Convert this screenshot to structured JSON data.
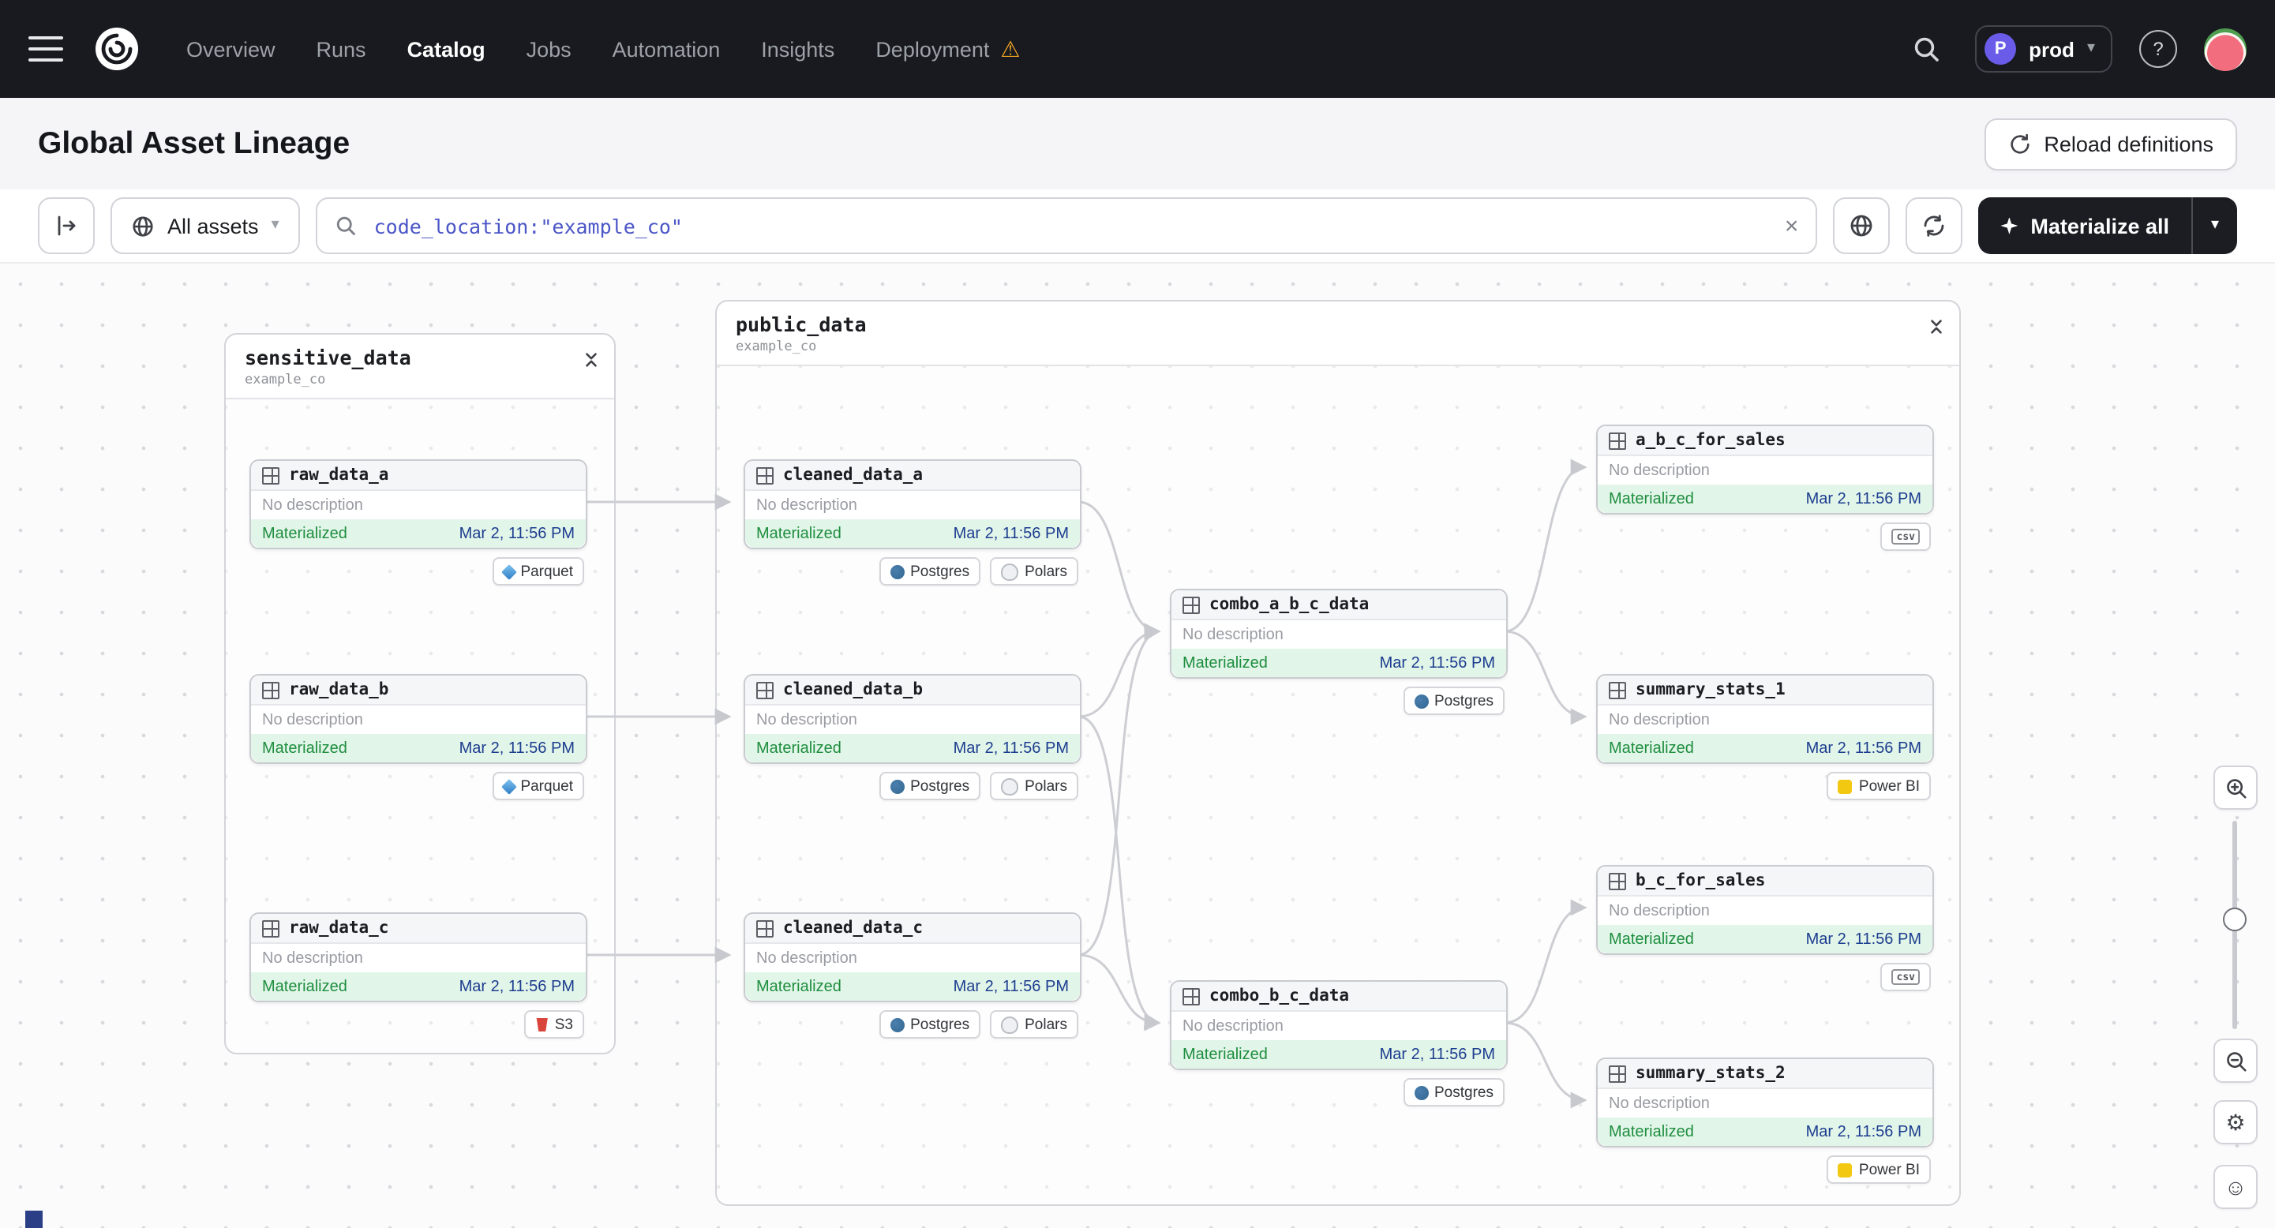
{
  "navbar": {
    "links": [
      {
        "label": "Overview"
      },
      {
        "label": "Runs"
      },
      {
        "label": "Catalog"
      },
      {
        "label": "Jobs"
      },
      {
        "label": "Automation"
      },
      {
        "label": "Insights"
      },
      {
        "label": "Deployment"
      }
    ],
    "active_link": "Catalog",
    "env": {
      "initial": "P",
      "name": "prod"
    }
  },
  "header": {
    "title": "Global Asset Lineage",
    "reload_button": "Reload definitions"
  },
  "toolbar": {
    "asset_filter_label": "All assets",
    "search_value": "code_location:\"example_co\"",
    "materialize_label": "Materialize all"
  },
  "icons": {
    "caret_down": "▾",
    "warning": "⚠",
    "close": "×",
    "gear": "⚙",
    "smiley": "☺",
    "question_mark": "?"
  },
  "colors": {
    "navbar_bg": "#181a1f",
    "warning_orange": "#F5A623",
    "env_badge_purple": "#6a5ce8",
    "materialized_text": "#1e8e3e",
    "materialized_bg": "#e2f5e9",
    "timestamp_blue": "#1c3d8f",
    "search_text_blue": "#4a55c7",
    "powerbi_yellow": "#f2c811",
    "postgres_blue": "#336791",
    "s3_red": "#d9453b"
  },
  "graph": {
    "groups": [
      {
        "name": "sensitive_data",
        "location": "example_co"
      },
      {
        "name": "public_data",
        "location": "example_co"
      }
    ],
    "nodes": [
      {
        "name": "raw_data_a",
        "description": "No description",
        "status": "Materialized",
        "timestamp": "Mar 2, 11:56 PM",
        "tags": [
          {
            "label": "Parquet"
          }
        ]
      },
      {
        "name": "raw_data_b",
        "description": "No description",
        "status": "Materialized",
        "timestamp": "Mar 2, 11:56 PM",
        "tags": [
          {
            "label": "Parquet"
          }
        ]
      },
      {
        "name": "raw_data_c",
        "description": "No description",
        "status": "Materialized",
        "timestamp": "Mar 2, 11:56 PM",
        "tags": [
          {
            "label": "S3"
          }
        ]
      },
      {
        "name": "cleaned_data_a",
        "description": "No description",
        "status": "Materialized",
        "timestamp": "Mar 2, 11:56 PM",
        "tags": [
          {
            "label": "Postgres"
          },
          {
            "label": "Polars"
          }
        ]
      },
      {
        "name": "cleaned_data_b",
        "description": "No description",
        "status": "Materialized",
        "timestamp": "Mar 2, 11:56 PM",
        "tags": [
          {
            "label": "Postgres"
          },
          {
            "label": "Polars"
          }
        ]
      },
      {
        "name": "cleaned_data_c",
        "description": "No description",
        "status": "Materialized",
        "timestamp": "Mar 2, 11:56 PM",
        "tags": [
          {
            "label": "Postgres"
          },
          {
            "label": "Polars"
          }
        ]
      },
      {
        "name": "combo_a_b_c_data",
        "description": "No description",
        "status": "Materialized",
        "timestamp": "Mar 2, 11:56 PM",
        "tags": [
          {
            "label": "Postgres"
          }
        ]
      },
      {
        "name": "combo_b_c_data",
        "description": "No description",
        "status": "Materialized",
        "timestamp": "Mar 2, 11:56 PM",
        "tags": [
          {
            "label": "Postgres"
          }
        ]
      },
      {
        "name": "a_b_c_for_sales",
        "description": "No description",
        "status": "Materialized",
        "timestamp": "Mar 2, 11:56 PM",
        "tags": [
          {
            "label": "csv"
          }
        ]
      },
      {
        "name": "summary_stats_1",
        "description": "No description",
        "status": "Materialized",
        "timestamp": "Mar 2, 11:56 PM",
        "tags": [
          {
            "label": "Power BI"
          }
        ]
      },
      {
        "name": "b_c_for_sales",
        "description": "No description",
        "status": "Materialized",
        "timestamp": "Mar 2, 11:56 PM",
        "tags": [
          {
            "label": "csv"
          }
        ]
      },
      {
        "name": "summary_stats_2",
        "description": "No description",
        "status": "Materialized",
        "timestamp": "Mar 2, 11:56 PM",
        "tags": [
          {
            "label": "Power BI"
          }
        ]
      }
    ]
  }
}
